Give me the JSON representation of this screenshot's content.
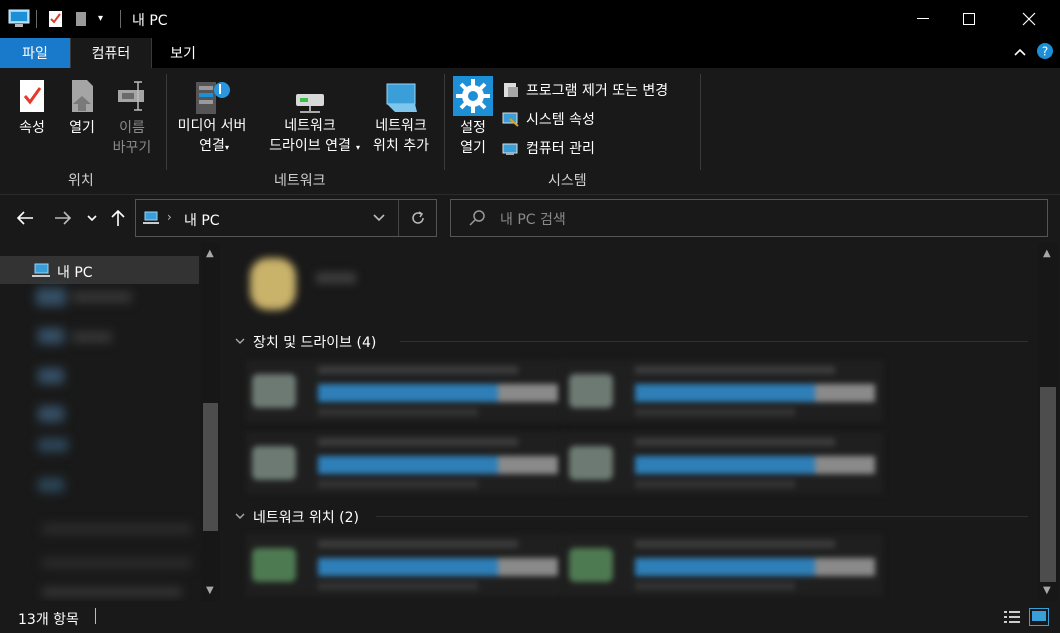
{
  "window": {
    "title": "내 PC"
  },
  "tabs": {
    "file": "파일",
    "computer": "컴퓨터",
    "view": "보기"
  },
  "ribbon": {
    "location": {
      "label": "위치",
      "properties": "속성",
      "open": "열기",
      "rename_1": "이름",
      "rename_2": "바꾸기"
    },
    "network": {
      "label": "네트워크",
      "media_1": "미디어 서버",
      "media_2": "연결",
      "drive_1": "네트워크",
      "drive_2": "드라이브 연결",
      "loc_1": "네트워크",
      "loc_2": "위치 추가"
    },
    "system": {
      "label": "시스템",
      "settings_1": "설정",
      "settings_2": "열기",
      "uninstall": "프로그램 제거 또는 변경",
      "sysprops": "시스템 속성",
      "manage": "컴퓨터 관리"
    }
  },
  "address": {
    "path": "내 PC",
    "search_placeholder": "내 PC 검색"
  },
  "navpane": {
    "this_pc": "내 PC"
  },
  "content": {
    "devices_header": "장치 및 드라이브 (4)",
    "network_header": "네트워크 위치 (2)"
  },
  "status": {
    "items": "13개 항목"
  },
  "colors": {
    "accent": "#1979ca",
    "background": "#191919",
    "titlebar": "#000000"
  }
}
